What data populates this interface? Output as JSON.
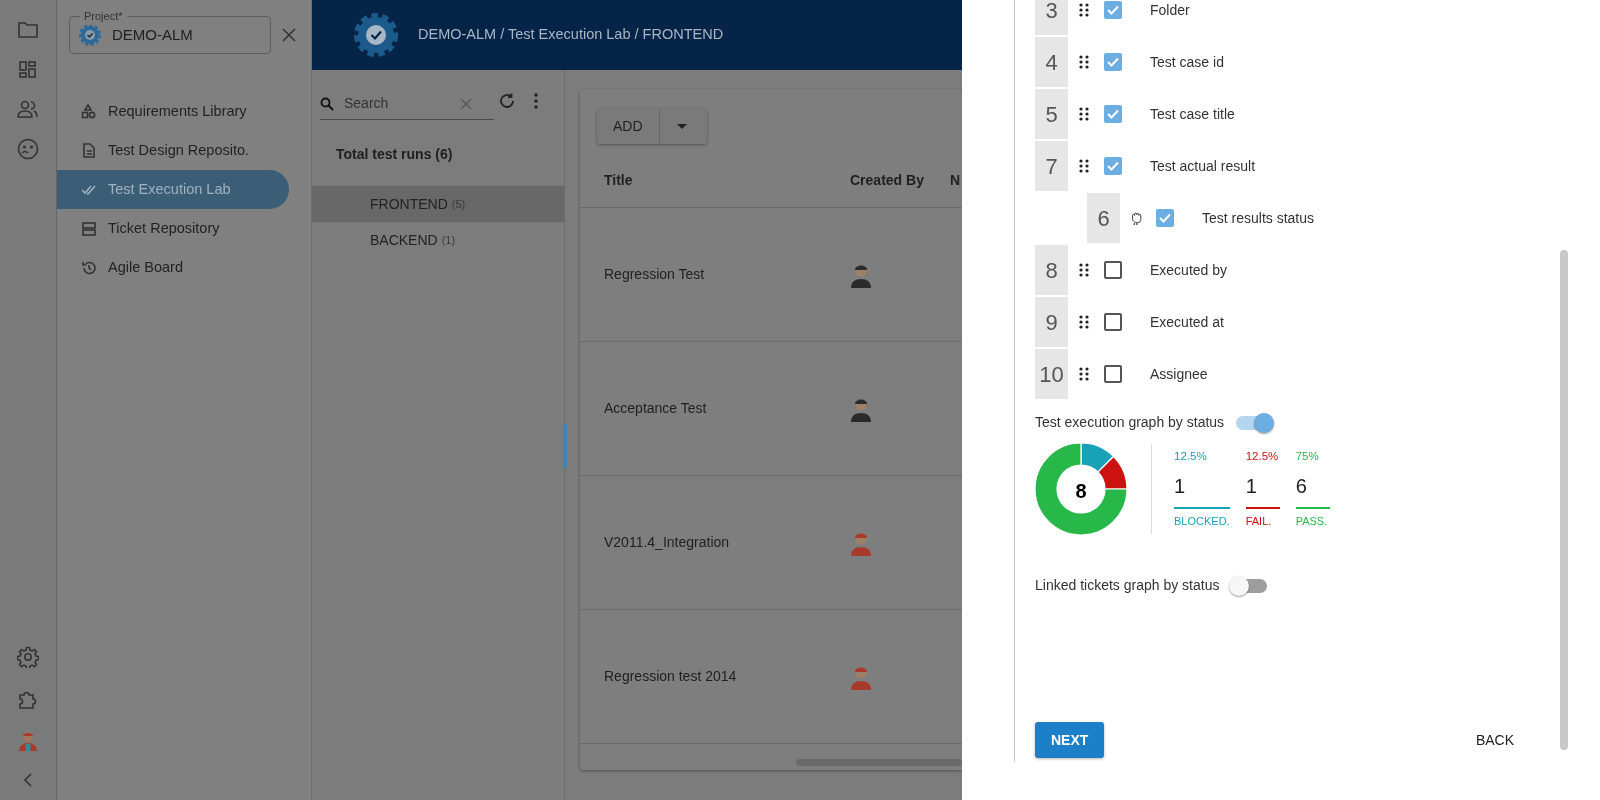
{
  "project_field": {
    "label": "Project*",
    "value": "DEMO-ALM"
  },
  "nav": [
    {
      "label": "Requirements Library",
      "selected": false
    },
    {
      "label": "Test Design Reposito.",
      "selected": false
    },
    {
      "label": "Test Execution Lab",
      "selected": true
    },
    {
      "label": "Ticket Repository",
      "selected": false
    },
    {
      "label": "Agile Board",
      "selected": false
    }
  ],
  "header": {
    "breadcrumb": "DEMO-ALM / Test Execution Lab / FRONTEND"
  },
  "tree": {
    "search": {
      "placeholder": "Search"
    },
    "total": "Total test runs (6)",
    "items": [
      {
        "label": "FRONTEND",
        "count": "(5)",
        "selected": true
      },
      {
        "label": "BACKEND",
        "count": "(1)",
        "selected": false
      }
    ]
  },
  "table": {
    "add_button": "ADD",
    "columns": [
      "Title",
      "Created By",
      "N"
    ],
    "rows": [
      {
        "title": "Regression Test",
        "color": "#2b2b2b"
      },
      {
        "title": "Acceptance Test",
        "color": "#2b2b2b"
      },
      {
        "title": "V2011.4_Integration",
        "color": "#a83a2c"
      },
      {
        "title": "Regression test 2014",
        "color": "#a83a2c"
      }
    ]
  },
  "column_settings": [
    {
      "number": "3",
      "label": "Folder",
      "checked": true
    },
    {
      "number": "4",
      "label": "Test case id",
      "checked": true
    },
    {
      "number": "5",
      "label": "Test case title",
      "checked": true
    },
    {
      "number": "7",
      "label": "Test actual result",
      "checked": true,
      "children": [
        {
          "number": "6",
          "label": "Test results status",
          "checked": true
        }
      ]
    },
    {
      "number": "8",
      "label": "Executed by",
      "checked": false
    },
    {
      "number": "9",
      "label": "Executed at",
      "checked": false
    },
    {
      "number": "10",
      "label": "Assignee",
      "checked": false
    }
  ],
  "execution_graph": {
    "label": "Test execution graph by status",
    "on": true,
    "total": "8",
    "chart_data": {
      "type": "donut",
      "categories": [
        "BLOCKED.",
        "FAIL.",
        "PASS."
      ],
      "values": [
        12.5,
        12.5,
        75
      ]
    },
    "stats": [
      {
        "percent": "12.5%",
        "count": "1",
        "color": "#17a2b8"
      },
      {
        "percent": "12.5%",
        "count": "1",
        "color": "#cc1111"
      },
      {
        "percent": "75%",
        "count": "6",
        "color": "#28b84a"
      }
    ]
  },
  "linked_graph": {
    "label": "Linked tickets graph by status",
    "on": false
  },
  "buttons": {
    "next": "NEXT",
    "back": "BACK"
  }
}
